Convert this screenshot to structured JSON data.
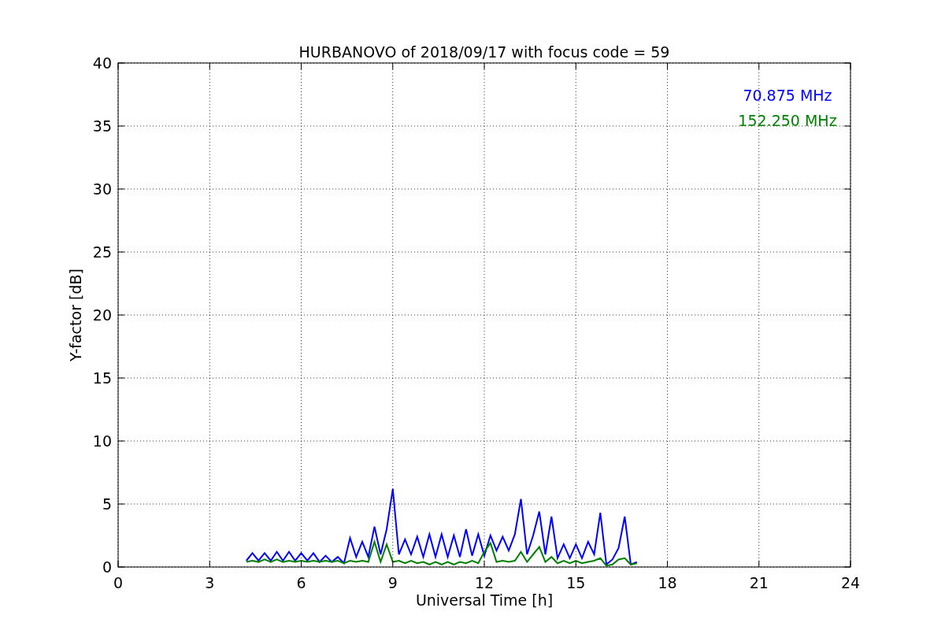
{
  "chart_data": {
    "type": "line",
    "title": "HURBANOVO of 2018/09/17 with focus code = 59",
    "xlabel": "Universal Time [h]",
    "ylabel": "Y-factor [dB]",
    "x": [
      4.2,
      4.4,
      4.6,
      4.8,
      5.0,
      5.2,
      5.4,
      5.6,
      5.8,
      6.0,
      6.2,
      6.4,
      6.6,
      6.8,
      7.0,
      7.2,
      7.4,
      7.6,
      7.8,
      8.0,
      8.2,
      8.4,
      8.6,
      8.8,
      9.0,
      9.2,
      9.4,
      9.6,
      9.8,
      10.0,
      10.2,
      10.4,
      10.6,
      10.8,
      11.0,
      11.2,
      11.4,
      11.6,
      11.8,
      12.0,
      12.2,
      12.4,
      12.6,
      12.8,
      13.0,
      13.2,
      13.4,
      13.6,
      13.8,
      14.0,
      14.2,
      14.4,
      14.6,
      14.8,
      15.0,
      15.2,
      15.4,
      15.6,
      15.8,
      16.0,
      16.2,
      16.4,
      16.6,
      16.8,
      17.0
    ],
    "series": [
      {
        "name": "70.875 MHz",
        "color": "#0000ff",
        "values": [
          0.5,
          1.1,
          0.5,
          1.1,
          0.5,
          1.2,
          0.5,
          1.2,
          0.5,
          1.1,
          0.5,
          1.1,
          0.4,
          0.9,
          0.4,
          0.8,
          0.3,
          2.3,
          0.8,
          2.0,
          0.8,
          3.2,
          1.0,
          3.0,
          6.2,
          1.0,
          2.2,
          1.0,
          2.4,
          0.8,
          2.6,
          0.8,
          2.6,
          0.8,
          2.5,
          0.8,
          3.0,
          0.9,
          2.6,
          0.9,
          2.5,
          1.3,
          2.4,
          1.3,
          2.6,
          5.4,
          1.0,
          2.5,
          4.4,
          1.0,
          4.0,
          0.7,
          1.8,
          0.7,
          1.8,
          0.7,
          2.0,
          1.0,
          4.3,
          0.2,
          0.6,
          1.5,
          4.0,
          0.2,
          0.4
        ]
      },
      {
        "name": "152.250 MHz",
        "color": "#008000",
        "values": [
          0.4,
          0.5,
          0.4,
          0.6,
          0.4,
          0.6,
          0.4,
          0.5,
          0.4,
          0.5,
          0.4,
          0.5,
          0.4,
          0.5,
          0.4,
          0.5,
          0.3,
          0.5,
          0.4,
          0.5,
          0.4,
          2.0,
          0.4,
          1.8,
          0.4,
          0.5,
          0.3,
          0.5,
          0.3,
          0.4,
          0.2,
          0.4,
          0.2,
          0.4,
          0.2,
          0.4,
          0.3,
          0.5,
          0.3,
          1.2,
          1.9,
          0.4,
          0.5,
          0.4,
          0.5,
          1.2,
          0.4,
          1.0,
          1.6,
          0.4,
          0.8,
          0.3,
          0.5,
          0.3,
          0.5,
          0.3,
          0.4,
          0.5,
          0.7,
          0.1,
          0.2,
          0.6,
          0.7,
          0.2,
          0.3
        ]
      }
    ],
    "xlim": [
      0,
      24
    ],
    "ylim": [
      0,
      40
    ],
    "xticks": [
      0,
      3,
      6,
      9,
      12,
      15,
      18,
      21,
      24
    ],
    "yticks": [
      0,
      5,
      10,
      15,
      20,
      25,
      30,
      35,
      40
    ],
    "grid": true
  }
}
